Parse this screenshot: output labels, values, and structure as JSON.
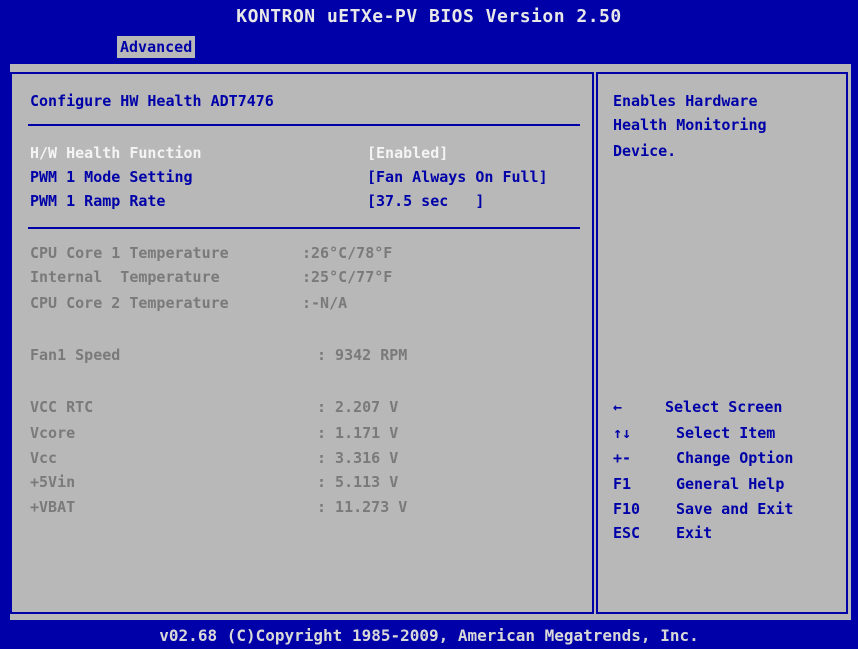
{
  "window": {
    "title": "KONTRON uETXe-PV BIOS Version 2.50",
    "active_tab": "Advanced"
  },
  "section_title": "Configure HW Health ADT7476",
  "settings": [
    {
      "label": "H/W Health Function",
      "value": "[Enabled]"
    },
    {
      "label": "PWM 1 Mode Setting",
      "value": "[Fan Always On Full]"
    },
    {
      "label": "PWM 1 Ramp Rate",
      "value": "[37.5 sec   ]"
    }
  ],
  "readings": [
    {
      "label": "CPU Core 1 Temperature",
      "value": ":26°C/78°F"
    },
    {
      "label": "Internal  Temperature",
      "value": ":25°C/77°F"
    },
    {
      "label": "CPU Core 2 Temperature",
      "value": ":-N/A"
    },
    {
      "label": "Fan1 Speed",
      "value": ": 9342 RPM"
    },
    {
      "label": "VCC RTC",
      "value": ": 2.207 V"
    },
    {
      "label": "Vcore",
      "value": ": 1.171 V"
    },
    {
      "label": "Vcc",
      "value": ": 3.316 V"
    },
    {
      "label": "+5Vin",
      "value": ": 5.113 V"
    },
    {
      "label": "+VBAT",
      "value": ": 11.273 V"
    }
  ],
  "help": {
    "line1": "Enables Hardware",
    "line2": "Health Monitoring",
    "line3": "Device."
  },
  "keys": [
    {
      "key": "←",
      "action": "Select Screen"
    },
    {
      "key": "↑↓",
      "action": "Select Item"
    },
    {
      "key": "+-",
      "action": "Change Option"
    },
    {
      "key": "F1",
      "action": "General Help"
    },
    {
      "key": "F10",
      "action": "Save and Exit"
    },
    {
      "key": "ESC",
      "action": "Exit"
    }
  ],
  "footer": "v02.68 (C)Copyright 1985-2009, American Megatrends, Inc.",
  "colors": {
    "background": "#0000a8",
    "panel": "#b8b8b8",
    "selected": "#f4f4f4",
    "disabled": "#7a7a7a"
  }
}
